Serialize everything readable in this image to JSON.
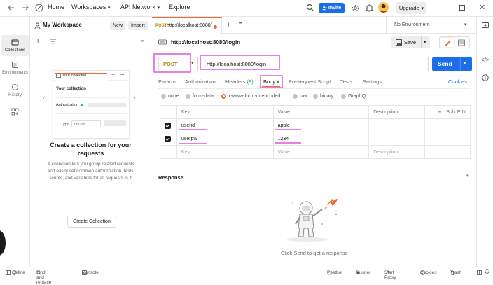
{
  "topbar": {
    "home": "Home",
    "workspaces": "Workspaces",
    "api_network": "API Network",
    "explore": "Explore",
    "invite": "Invite",
    "upgrade": "Upgrade"
  },
  "rail": {
    "collections": "Collections",
    "environments": "Environments",
    "history": "History"
  },
  "sidebar": {
    "workspace_name": "My Workspace",
    "new_label": "New",
    "import_label": "Import",
    "preview_tab": "Your collecton",
    "preview_title": "Your collection",
    "preview_item": "Authorization",
    "preview_type": "Type",
    "preview_api_key": "API Key",
    "empty_title": "Create a collection for your requests",
    "empty_text": "A collection lets you group related requests and easily set common authorization, tests, scripts, and variables for all requests in it.",
    "create_button": "Create Collection"
  },
  "tabs": {
    "method": "POST",
    "url_label": "http://localhost:8080/",
    "environment": "No Environment"
  },
  "request": {
    "url_title": "http://localhost:8080/login",
    "save": "Save",
    "method": "POST",
    "url": "http://localhost:8080/login",
    "send": "Send",
    "cookies": "Cookies"
  },
  "subtabs": {
    "params": "Params",
    "authorization": "Authorization",
    "headers": "Headers",
    "headers_count": "(8)",
    "body": "Body",
    "prerequest": "Pre-request Script",
    "tests": "Tests",
    "settings": "Settings"
  },
  "body_types": {
    "none": "none",
    "form_data": "form-data",
    "urlencoded": "x-www-form-urlencoded",
    "raw": "raw",
    "binary": "binary",
    "graphql": "GraphQL"
  },
  "table": {
    "headers": {
      "key": "Key",
      "value": "Value",
      "description": "Description",
      "bulk_edit": "Bulk Edit"
    },
    "rows": [
      {
        "key": "userid",
        "value": "apple"
      },
      {
        "key": "userpw",
        "value": "1234"
      }
    ],
    "placeholder": {
      "key": "Key",
      "value": "Value",
      "description": "Description"
    }
  },
  "response": {
    "title": "Response",
    "empty_text": "Click Send to get a response"
  },
  "statusbar": {
    "online": "Online",
    "find_replace": "Find and replace",
    "console": "Console",
    "postbot": "Postbot",
    "runner": "Runner",
    "start_proxy": "Start Proxy",
    "cookies": "Cookies",
    "trash": "Trash"
  },
  "colors": {
    "accent": "#1c6ee8",
    "post_orange": "#c27e0a",
    "highlight": "#e97ee7",
    "brand_orange": "#ec6b2d"
  }
}
